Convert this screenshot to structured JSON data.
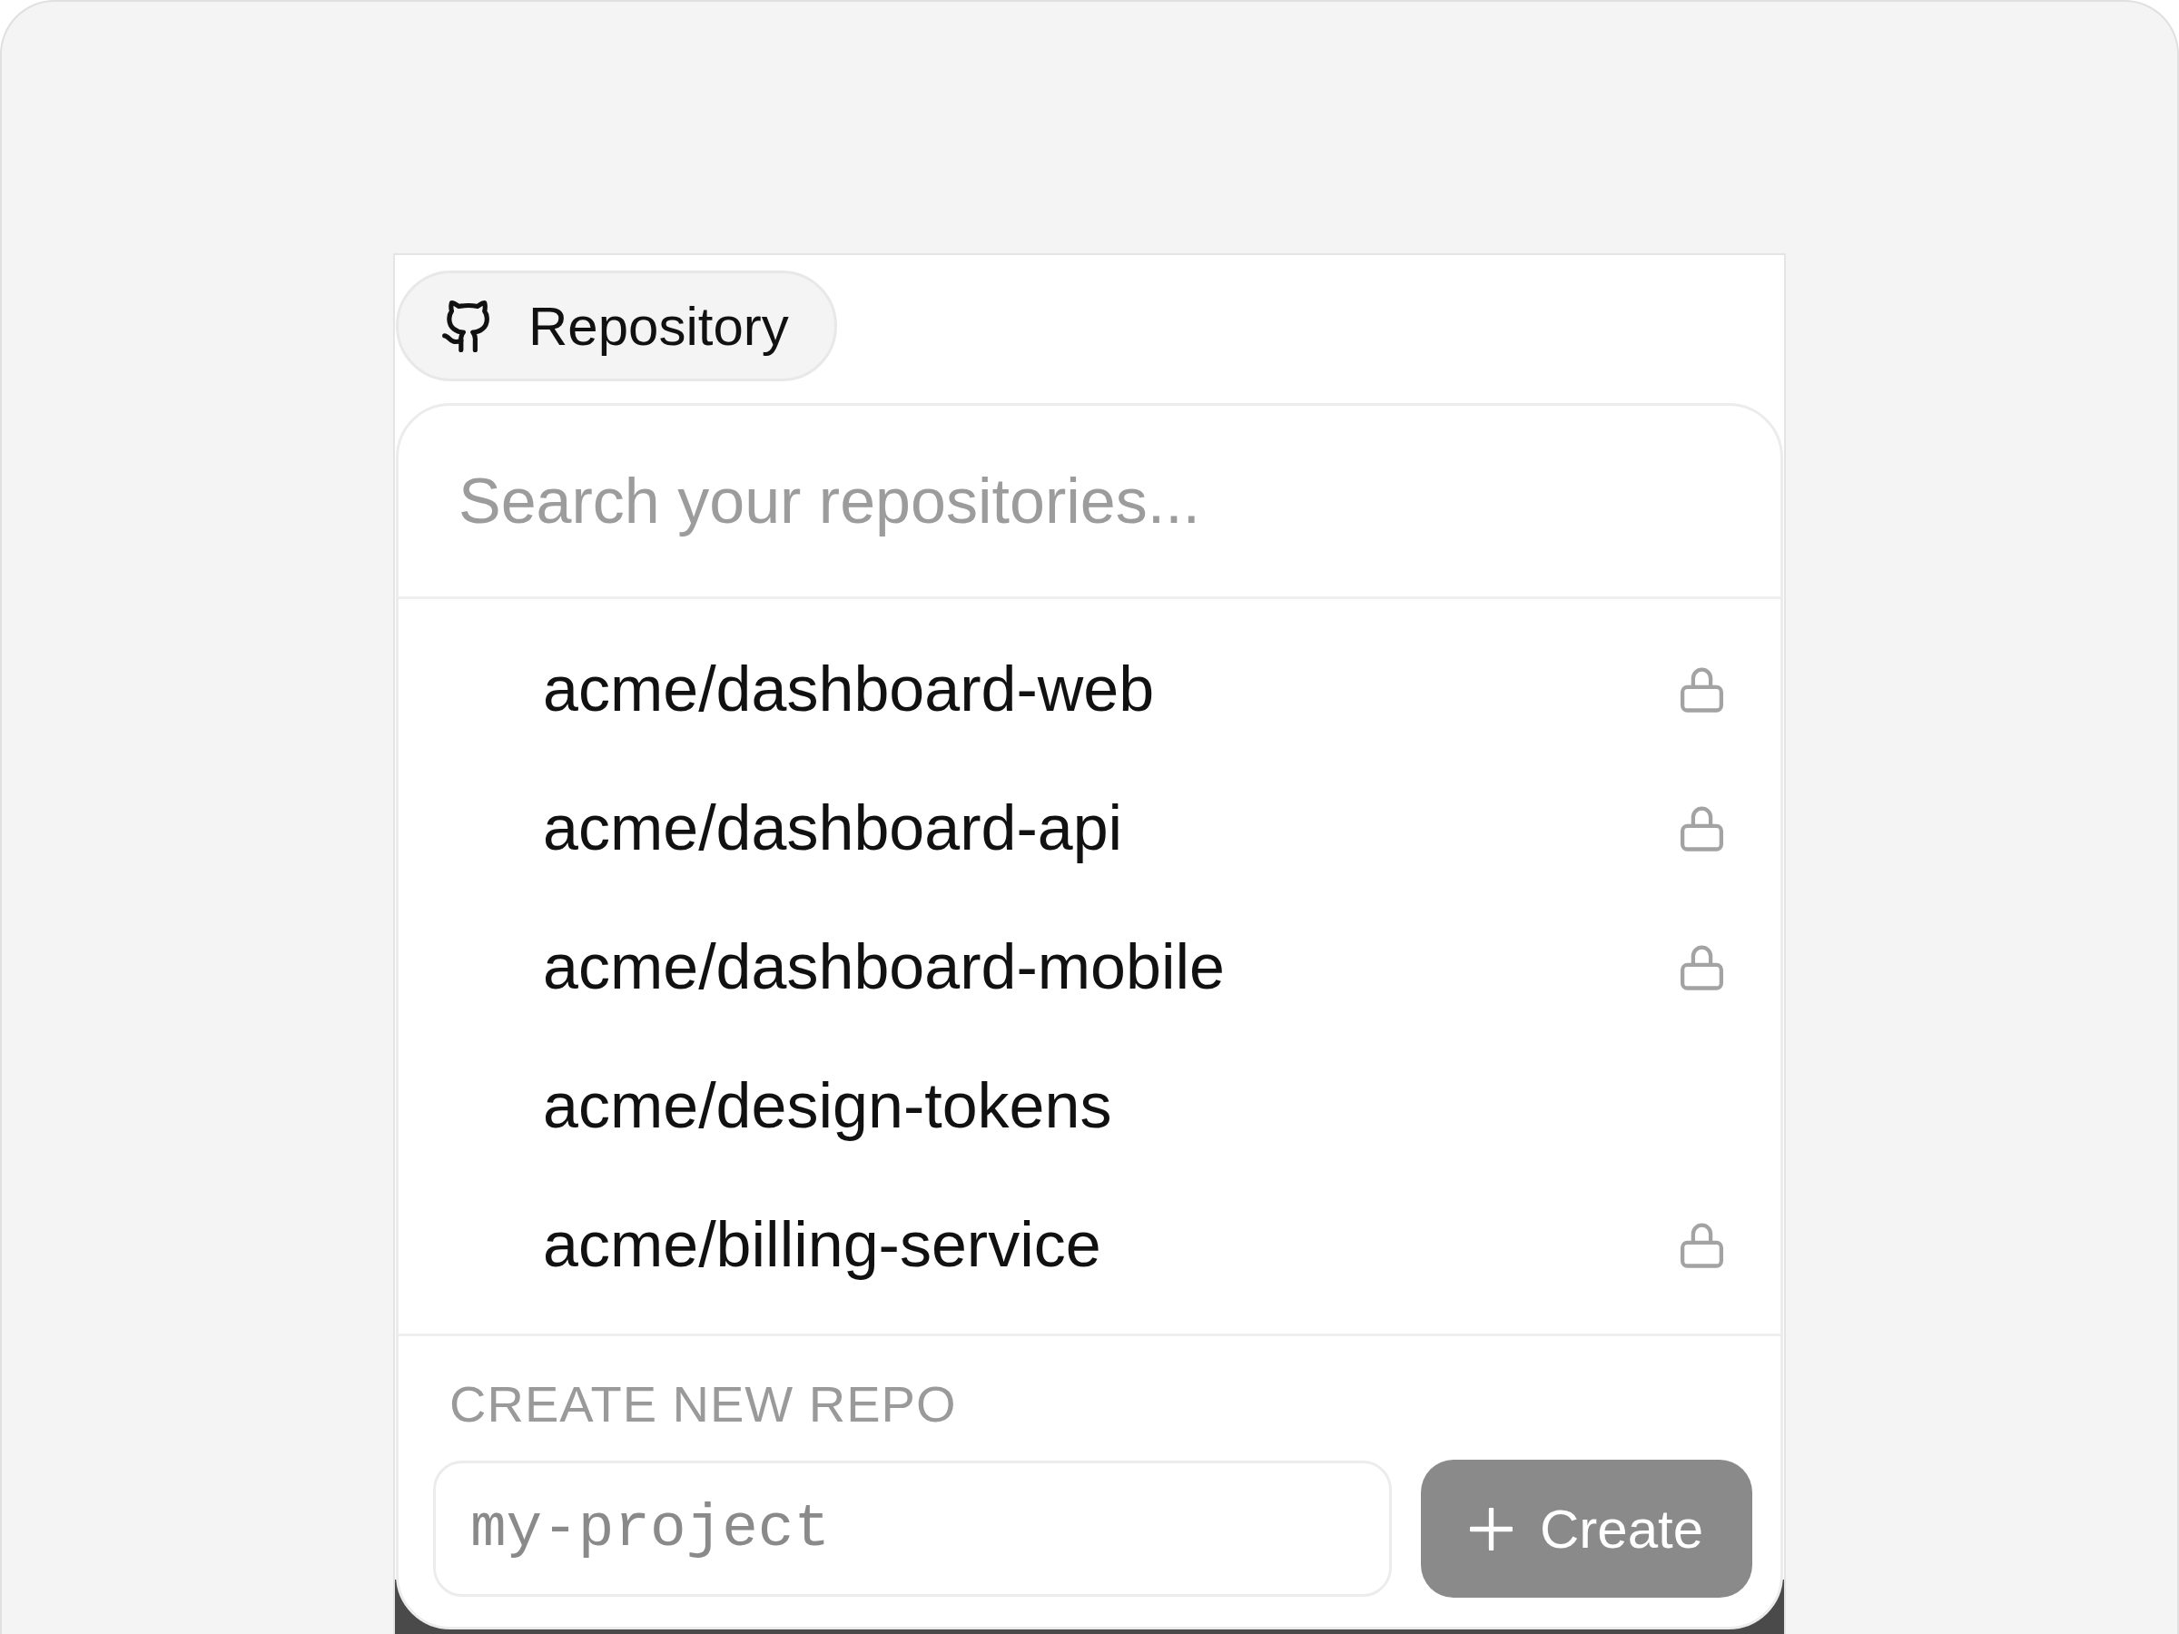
{
  "chip": {
    "label": "Repository"
  },
  "popup": {
    "search": {
      "placeholder": "Search your repositories..."
    },
    "repositories": [
      {
        "name": "acme/dashboard-web",
        "private": true,
        "selected": false
      },
      {
        "name": "acme/dashboard-api",
        "private": true,
        "selected": false
      },
      {
        "name": "acme/dashboard-mobile",
        "private": true,
        "selected": false
      },
      {
        "name": "acme/design-tokens",
        "private": false,
        "selected": false
      },
      {
        "name": "acme/billing-service",
        "private": true,
        "selected": false
      }
    ],
    "create": {
      "heading": "CREATE NEW REPO",
      "input": {
        "placeholder": "my-project"
      },
      "button": {
        "label": "Create",
        "disabled": true
      }
    }
  }
}
